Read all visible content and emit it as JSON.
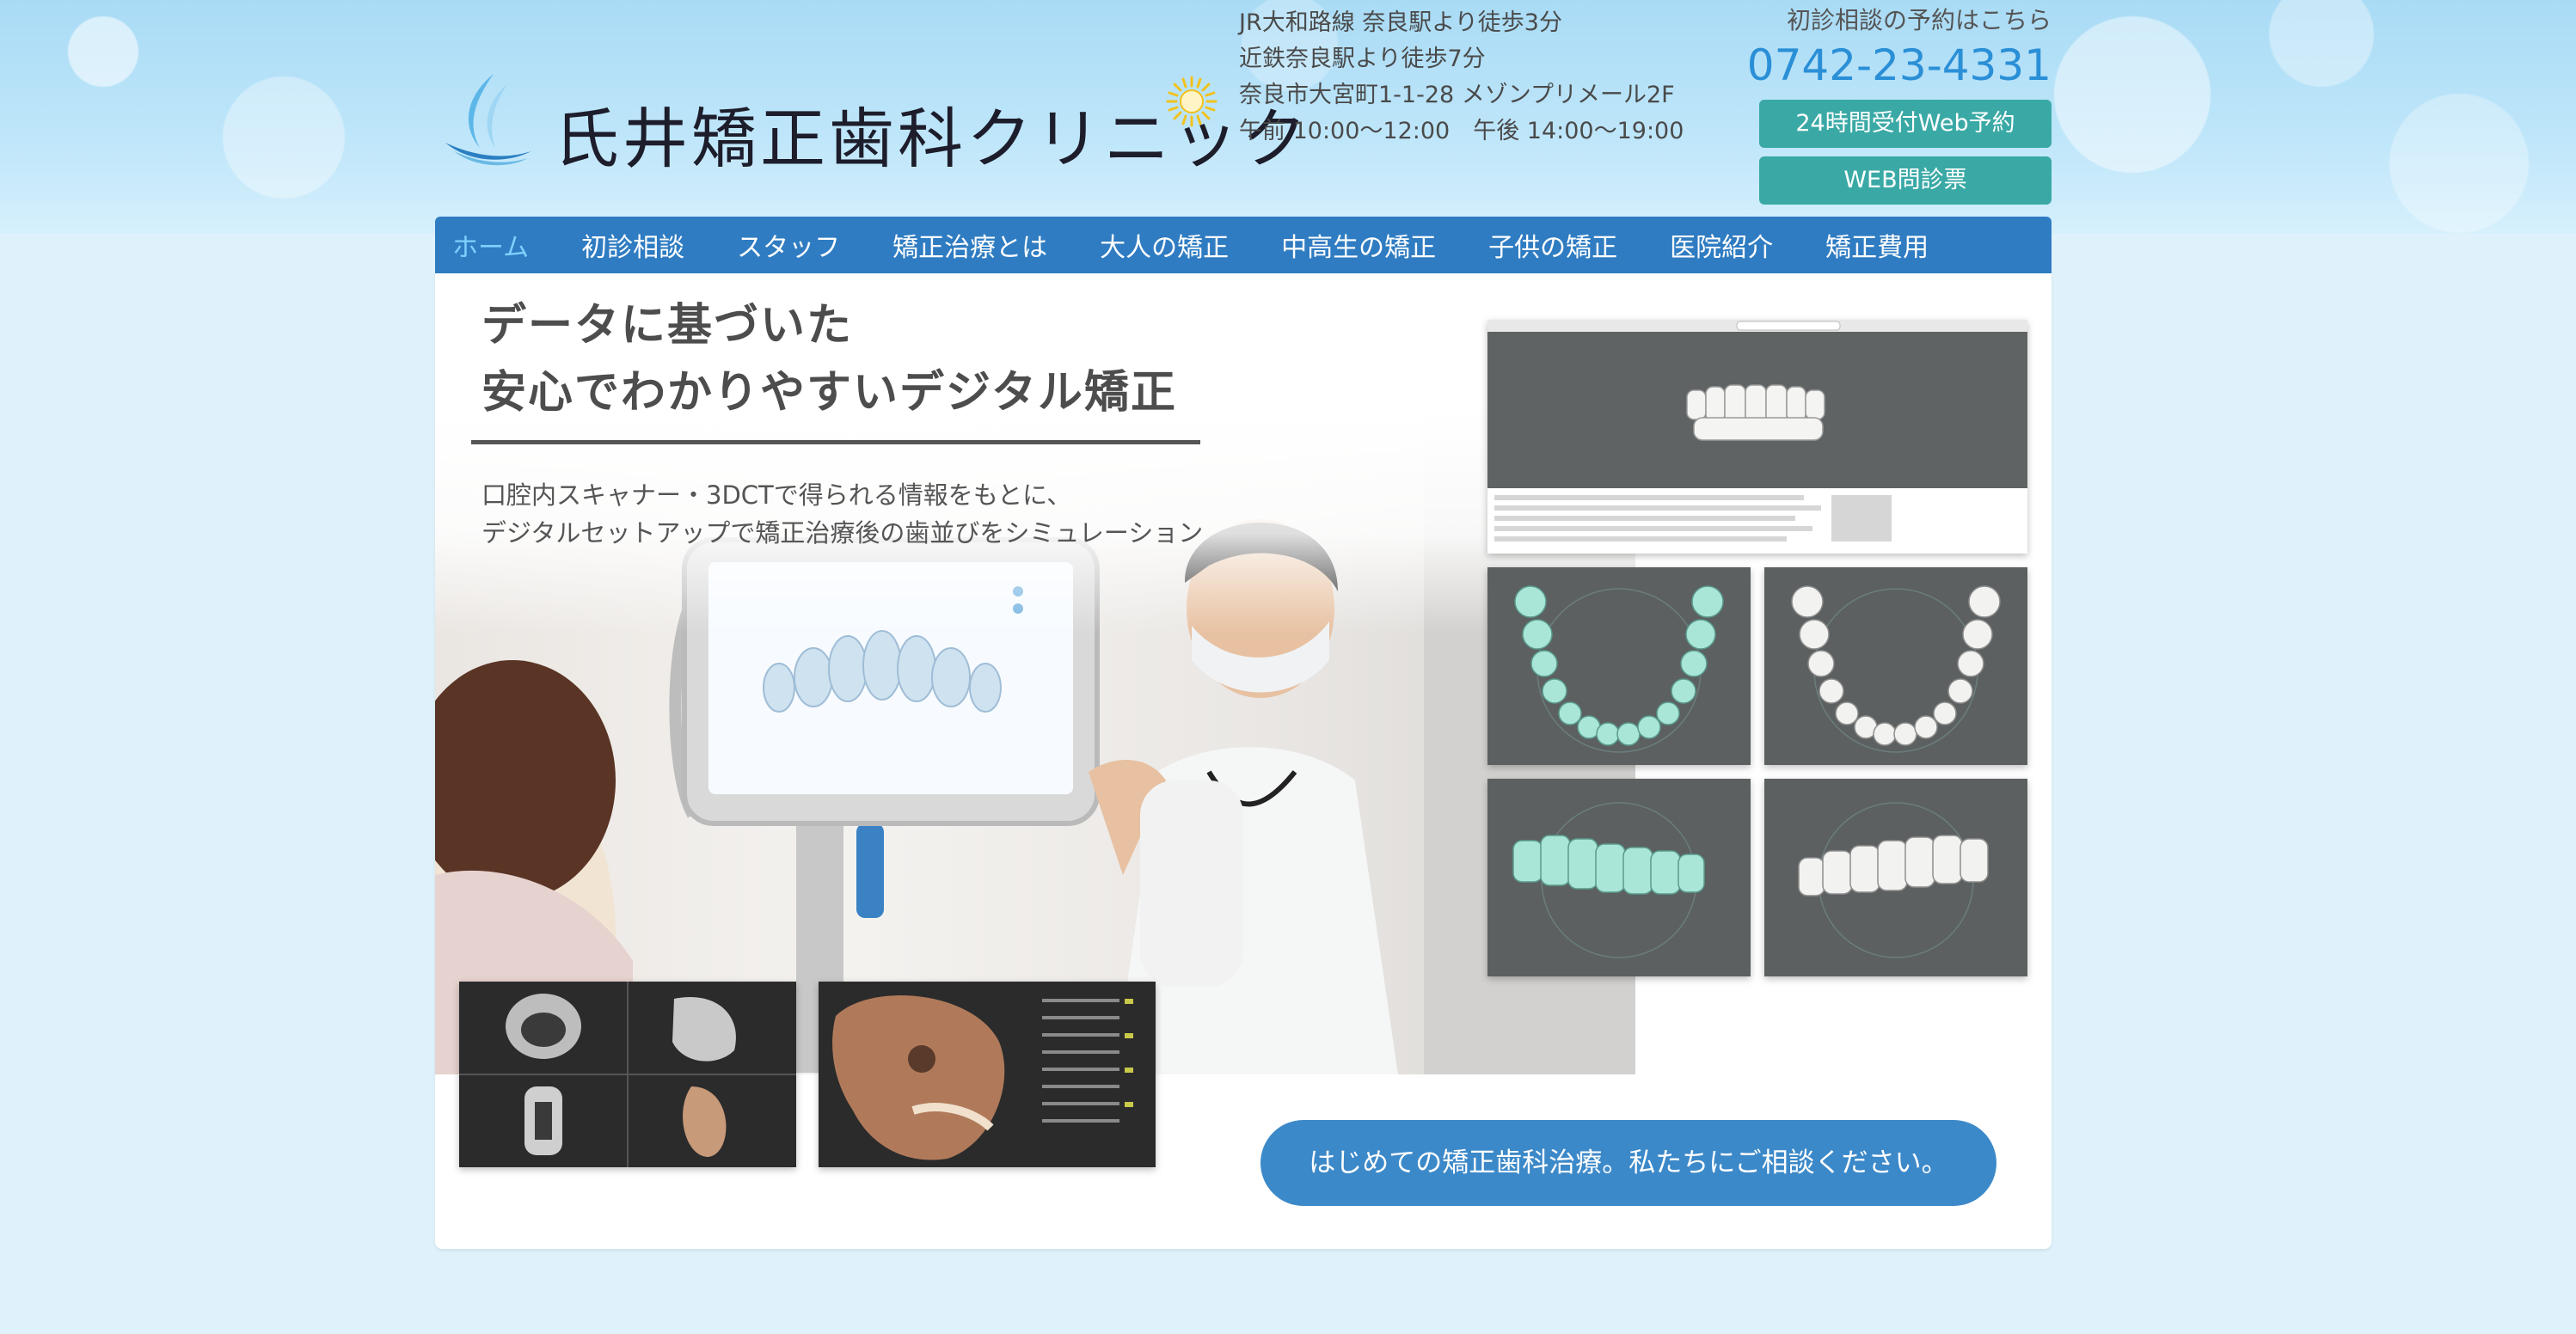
{
  "header": {
    "logo_text": "氏井矯正歯科クリニック",
    "access_lines": [
      "JR大和路線 奈良駅より徒歩3分",
      "近鉄奈良駅より徒歩7分",
      "奈良市大宮町1-1-28 メゾンプリメール2F",
      "午前 10:00〜12:00　午後 14:00〜19:00"
    ],
    "contact": {
      "label": "初診相談の予約はこちら",
      "phone": "0742-23-4331",
      "web_reserve": "24時間受付Web予約",
      "web_questionnaire": "WEB問診票"
    }
  },
  "nav": {
    "items": [
      "ホーム",
      "初診相談",
      "スタッフ",
      "矯正治療とは",
      "大人の矯正",
      "中高生の矯正",
      "子供の矯正",
      "医院紹介",
      "矯正費用"
    ],
    "active": "ホーム"
  },
  "hero": {
    "title_line1": "データに基づいた",
    "title_line2": "安心でわかりやすいデジタル矯正",
    "subtitle_line1": "口腔内スキャナー・3DCTで得られる情報をもとに、",
    "subtitle_line2": "デジタルセットアップで矯正治療後の歯並びをシミュレーション",
    "cta": "はじめての矯正歯科治療。私たちにご相談ください。"
  },
  "colors": {
    "nav_bg": "#2f7cc2",
    "nav_active": "#7fd0ff",
    "teal_button": "#3aa9a6",
    "cta_bg": "#3c89c9",
    "phone": "#2a8fd6"
  }
}
